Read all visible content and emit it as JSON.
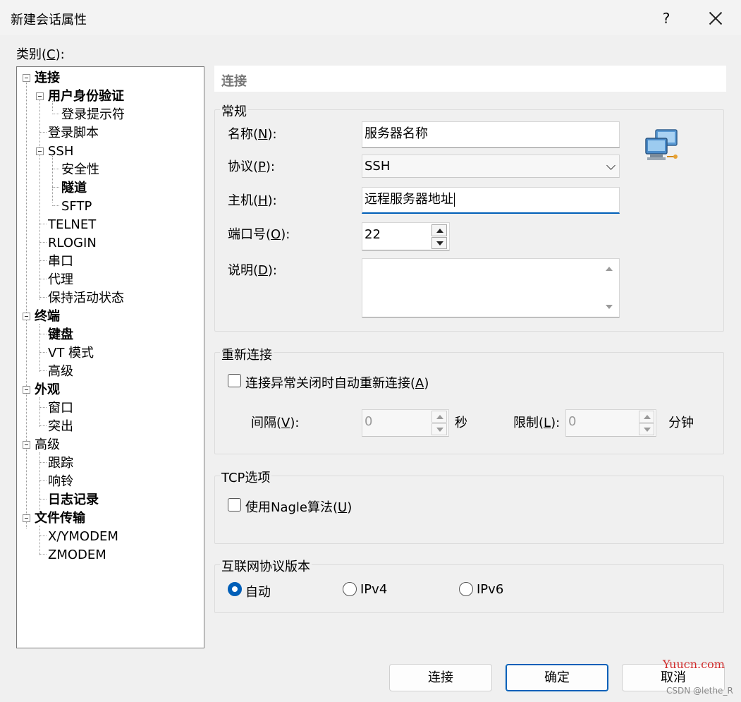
{
  "window": {
    "title": "新建会话属性",
    "help_label": "?"
  },
  "category_label": {
    "text": "类别(",
    "key": "C",
    "end": "):"
  },
  "tree": [
    {
      "label": "连接",
      "bold": true
    },
    {
      "label": "用户身份验证",
      "bold": true
    },
    {
      "label": "登录提示符",
      "bold": false
    },
    {
      "label": "登录脚本",
      "bold": false
    },
    {
      "label": "SSH",
      "bold": false
    },
    {
      "label": "安全性",
      "bold": false
    },
    {
      "label": "隧道",
      "bold": true
    },
    {
      "label": "SFTP",
      "bold": false
    },
    {
      "label": "TELNET",
      "bold": false
    },
    {
      "label": "RLOGIN",
      "bold": false
    },
    {
      "label": "串口",
      "bold": false
    },
    {
      "label": "代理",
      "bold": false
    },
    {
      "label": "保持活动状态",
      "bold": false
    },
    {
      "label": "终端",
      "bold": true
    },
    {
      "label": "键盘",
      "bold": true
    },
    {
      "label": "VT 模式",
      "bold": false
    },
    {
      "label": "高级",
      "bold": false
    },
    {
      "label": "外观",
      "bold": true
    },
    {
      "label": "窗口",
      "bold": false
    },
    {
      "label": "突出",
      "bold": false
    },
    {
      "label": "高级",
      "bold": false
    },
    {
      "label": "跟踪",
      "bold": false
    },
    {
      "label": "响铃",
      "bold": false
    },
    {
      "label": "日志记录",
      "bold": true
    },
    {
      "label": "文件传输",
      "bold": true
    },
    {
      "label": "X/YMODEM",
      "bold": false
    },
    {
      "label": "ZMODEM",
      "bold": false
    }
  ],
  "panel_header": "连接",
  "general": {
    "title": "常规",
    "name_label": {
      "pre": "名称(",
      "key": "N",
      "post": "):"
    },
    "name_value": "服务器名称",
    "protocol_label": {
      "pre": "协议(",
      "key": "P",
      "post": "):"
    },
    "protocol_value": "SSH",
    "host_label": {
      "pre": "主机(",
      "key": "H",
      "post": "):"
    },
    "host_value": "远程服务器地址",
    "port_label": {
      "pre": "端口号(",
      "key": "O",
      "post": "):"
    },
    "port_value": "22",
    "desc_label": {
      "pre": "说明(",
      "key": "D",
      "post": "):"
    },
    "desc_value": ""
  },
  "reconnect": {
    "title": "重新连接",
    "checkbox": {
      "pre": "连接异常关闭时自动重新连接(",
      "key": "A",
      "post": ")"
    },
    "interval_label": {
      "pre": "间隔(",
      "key": "V",
      "post": "):"
    },
    "interval_value": "0",
    "interval_unit": "秒",
    "limit_label": {
      "pre": "限制(",
      "key": "L",
      "post": "):"
    },
    "limit_value": "0",
    "limit_unit": "分钟"
  },
  "tcp": {
    "title": "TCP选项",
    "checkbox": {
      "pre": "使用Nagle算法(",
      "key": "U",
      "post": ")"
    }
  },
  "ip": {
    "title": "互联网协议版本",
    "options": [
      "自动",
      "IPv4",
      "IPv6"
    ]
  },
  "buttons": {
    "connect": "连接",
    "ok": "确定",
    "cancel": "取消"
  },
  "watermark": {
    "site": "Yuucn.com",
    "author": "CSDN @lethe_R"
  },
  "colors": {
    "accent": "#005fb8",
    "background": "#f0f0f0"
  }
}
